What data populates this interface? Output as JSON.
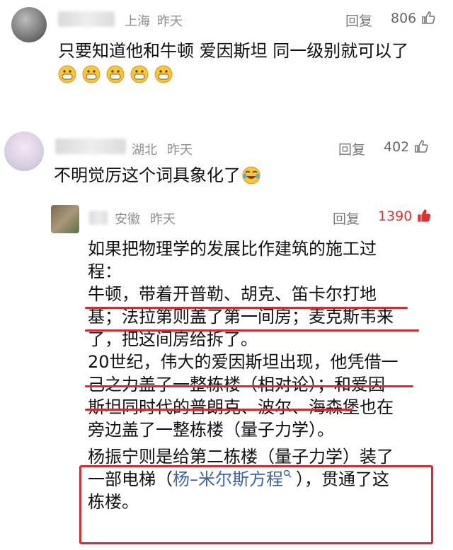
{
  "comments": [
    {
      "location": "上海",
      "time": "昨天",
      "reply": "回复",
      "likes": "806",
      "text": "只要知道他和牛顿 爱因斯坦 同一级别就可以了",
      "emoji_icon": "grinning-face-icon"
    },
    {
      "location": "湖北",
      "time": "昨天",
      "reply": "回复",
      "likes": "402",
      "text": "不明觉厉这个词具象化了",
      "emoji_icon": "tears-of-joy-icon"
    },
    {
      "location": "安徽",
      "time": "昨天",
      "reply": "回复",
      "likes": "1390",
      "lines": [
        "如果把物理学的发展比作建筑的施工过",
        "程：",
        "牛顿，带着开普勒、胡克、笛卡尔打地",
        "基；法拉第则盖了第一间房；麦克斯韦来",
        "了，把这间房给拆了。",
        "20世纪，伟大的爱因斯坦出现，他凭借一",
        "己之力盖了一整栋楼（相对论）；和爱因",
        "斯坦同时代的普朗克、波尔、海森堡也在",
        "旁边盖了一整栋楼（量子力学）。",
        "杨振宁则是给第二栋楼（量子力学）装了",
        "一部电梯（",
        "杨–米尔斯方程",
        "），贯通了这",
        "栋楼。"
      ]
    }
  ],
  "colors": {
    "accent_red": "#d62930",
    "link_blue": "#3d63a5",
    "hot_like_red": "#e0302e"
  }
}
